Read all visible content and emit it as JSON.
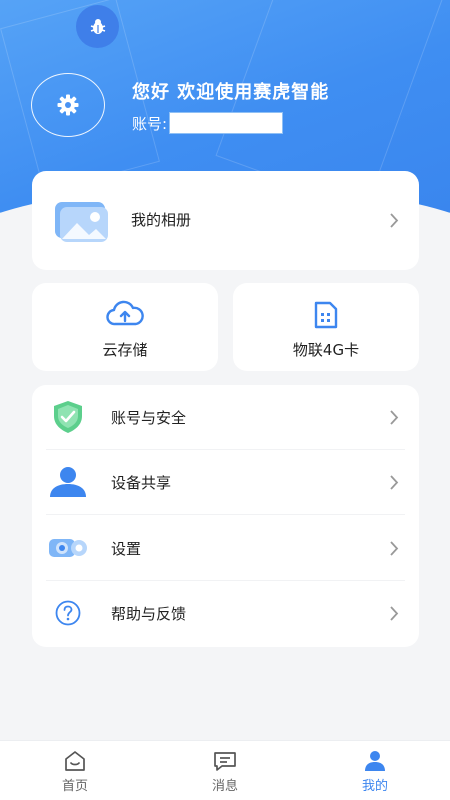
{
  "header": {
    "greeting": "您好 欢迎使用赛虎智能",
    "account_label": "账号:",
    "account_value": ""
  },
  "album": {
    "label": "我的相册"
  },
  "services": [
    {
      "label": "云存储",
      "icon": "cloud-upload-icon"
    },
    {
      "label": "物联4G卡",
      "icon": "sim-card-icon"
    }
  ],
  "menu": {
    "items": [
      {
        "label": "账号与安全",
        "icon": "shield-check-icon"
      },
      {
        "label": "设备共享",
        "icon": "user-icon"
      },
      {
        "label": "设置",
        "icon": "camera-settings-icon"
      },
      {
        "label": "帮助与反馈",
        "icon": "help-icon"
      }
    ]
  },
  "tabbar": {
    "tabs": [
      {
        "label": "首页",
        "icon": "home-icon"
      },
      {
        "label": "消息",
        "icon": "message-icon"
      },
      {
        "label": "我的",
        "icon": "profile-icon",
        "active": true
      }
    ]
  },
  "colors": {
    "accent": "#3d86ef",
    "background": "#f4f5f7"
  }
}
